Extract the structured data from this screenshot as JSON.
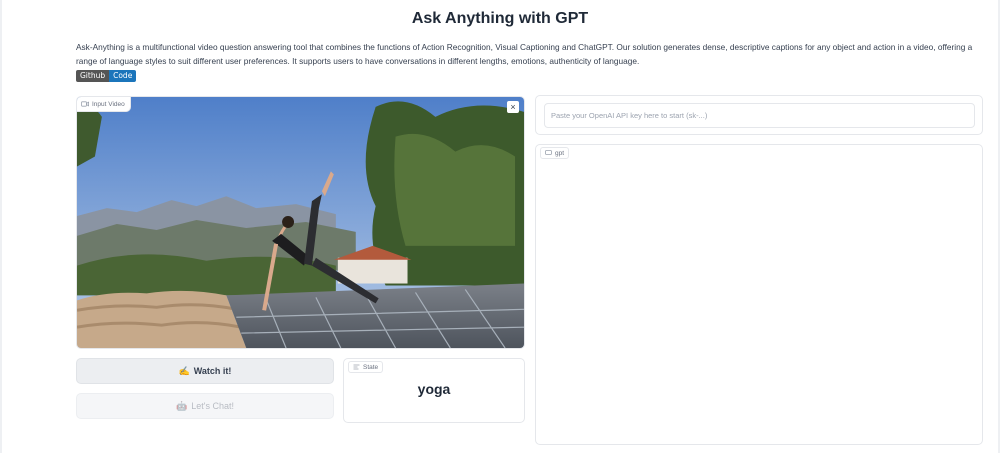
{
  "header": {
    "title": "Ask Anything with GPT",
    "description": "Ask-Anything is a multifunctional video question answering tool that combines the functions of Action Recognition, Visual Captioning and ChatGPT. Our solution generates dense, descriptive captions for any object and action in a video, offering a range of language styles to suit different user preferences. It supports users to have conversations in different lengths, emotions, authenticity of language.",
    "badge": {
      "left": "Github",
      "right": "Code"
    }
  },
  "video": {
    "label": "Input Video",
    "label_icon": "video-camera-icon",
    "close_icon": "close-icon",
    "close_glyph": "×"
  },
  "buttons": {
    "watch": {
      "emoji": "✍️",
      "label": "Watch it!"
    },
    "chat": {
      "emoji": "🤖",
      "label": "Let's Chat!"
    }
  },
  "state": {
    "label": "State",
    "label_icon": "textbox-icon",
    "value": "yoga"
  },
  "api": {
    "placeholder": "Paste your OpenAI API key here to start (sk-...)",
    "value": ""
  },
  "chat": {
    "label": "gpt",
    "label_icon": "chat-bubble-icon"
  },
  "colors": {
    "badge_left": "#555555",
    "badge_right": "#1b75bb",
    "border": "#e5e7eb"
  }
}
